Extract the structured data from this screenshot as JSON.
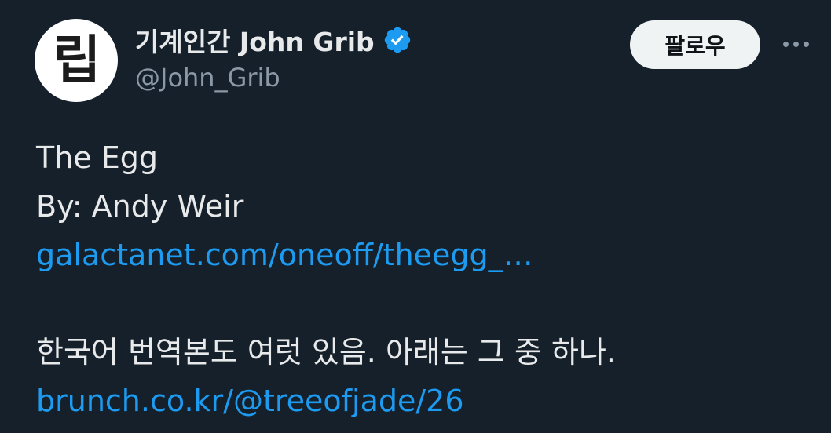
{
  "author": {
    "avatar_text": "립",
    "display_name": "기계인간 John Grib",
    "handle": "@John_Grib",
    "verified": true,
    "verified_color": "#1d9bf0"
  },
  "actions": {
    "follow_label": "팔로우",
    "more_icon": "more-horizontal-icon"
  },
  "tweet": {
    "line1": "The Egg",
    "line2": "By: Andy Weir",
    "link1": "galactanet.com/oneoff/theegg_…",
    "line3": "한국어 번역본도 여럿 있음. 아래는 그 중 하나.",
    "link2": "brunch.co.kr/@treeofjade/26"
  },
  "colors": {
    "background": "#15202b",
    "text": "#e7e9ea",
    "secondary_text": "#8b98a5",
    "link": "#1d9bf0",
    "button_bg": "#eff3f4"
  }
}
